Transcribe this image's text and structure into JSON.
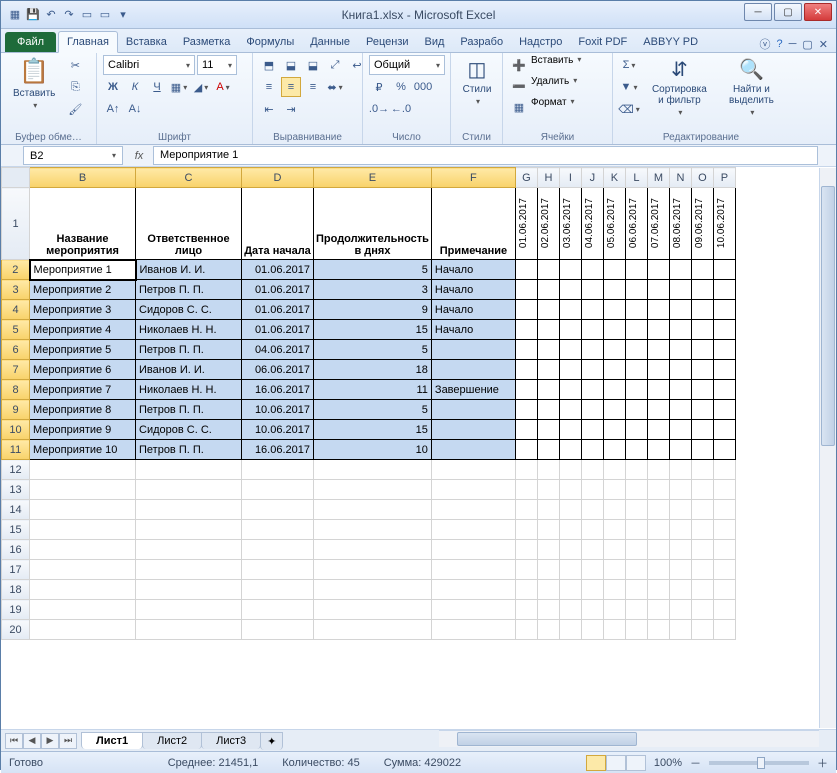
{
  "title": "Книга1.xlsx - Microsoft Excel",
  "tabs": {
    "file": "Файл",
    "home": "Главная",
    "insert": "Вставка",
    "layout": "Разметка",
    "formulas": "Формулы",
    "data": "Данные",
    "review": "Рецензи",
    "view": "Вид",
    "dev": "Разрабо",
    "add": "Надстро",
    "foxit": "Foxit PDF",
    "abbyy": "ABBYY PD"
  },
  "ribbon": {
    "clipboard": {
      "label": "Буфер обме…",
      "paste": "Вставить"
    },
    "font": {
      "label": "Шрифт",
      "name": "Calibri",
      "size": "11",
      "bold": "Ж",
      "italic": "К",
      "underline": "Ч"
    },
    "align": {
      "label": "Выравнивание"
    },
    "number": {
      "label": "Число",
      "format": "Общий"
    },
    "styles": {
      "label": "Стили",
      "btn": "Стили"
    },
    "cells": {
      "label": "Ячейки",
      "insert": "Вставить",
      "delete": "Удалить",
      "format": "Формат"
    },
    "editing": {
      "label": "Редактирование",
      "sort": "Сортировка и фильтр",
      "find": "Найти и выделить"
    }
  },
  "namebox": "B2",
  "formula": "Мероприятие 1",
  "columns": [
    "B",
    "C",
    "D",
    "E",
    "F",
    "G",
    "H",
    "I",
    "J",
    "K",
    "L",
    "M",
    "N",
    "O",
    "P"
  ],
  "headers": {
    "B": "Название мероприятия",
    "C": "Ответственное лицо",
    "D": "Дата начала",
    "E": "Продолжительность в днях",
    "F": "Примечание"
  },
  "date_headers": [
    "01.06.2017",
    "02.06.2017",
    "03.06.2017",
    "04.06.2017",
    "05.06.2017",
    "06.06.2017",
    "07.06.2017",
    "08.06.2017",
    "09.06.2017",
    "10.06.2017"
  ],
  "rows": [
    {
      "n": 2,
      "b": "Мероприятие 1",
      "c": "Иванов И. И.",
      "d": "01.06.2017",
      "e": "5",
      "f": "Начало"
    },
    {
      "n": 3,
      "b": "Мероприятие 2",
      "c": "Петров П. П.",
      "d": "01.06.2017",
      "e": "3",
      "f": "Начало"
    },
    {
      "n": 4,
      "b": "Мероприятие 3",
      "c": "Сидоров С. С.",
      "d": "01.06.2017",
      "e": "9",
      "f": "Начало"
    },
    {
      "n": 5,
      "b": "Мероприятие 4",
      "c": "Николаев Н. Н.",
      "d": "01.06.2017",
      "e": "15",
      "f": "Начало"
    },
    {
      "n": 6,
      "b": "Мероприятие 5",
      "c": "Петров П. П.",
      "d": "04.06.2017",
      "e": "5",
      "f": ""
    },
    {
      "n": 7,
      "b": "Мероприятие 6",
      "c": "Иванов И. И.",
      "d": "06.06.2017",
      "e": "18",
      "f": ""
    },
    {
      "n": 8,
      "b": "Мероприятие 7",
      "c": "Николаев Н. Н.",
      "d": "16.06.2017",
      "e": "11",
      "f": "Завершение"
    },
    {
      "n": 9,
      "b": "Мероприятие 8",
      "c": "Петров П. П.",
      "d": "10.06.2017",
      "e": "5",
      "f": ""
    },
    {
      "n": 10,
      "b": "Мероприятие 9",
      "c": "Сидоров С. С.",
      "d": "10.06.2017",
      "e": "15",
      "f": ""
    },
    {
      "n": 11,
      "b": "Мероприятие 10",
      "c": "Петров П. П.",
      "d": "16.06.2017",
      "e": "10",
      "f": ""
    }
  ],
  "empty_rows": [
    12,
    13,
    14,
    15,
    16,
    17,
    18,
    19,
    20
  ],
  "sheets": {
    "s1": "Лист1",
    "s2": "Лист2",
    "s3": "Лист3"
  },
  "status": {
    "ready": "Готово",
    "avg_label": "Среднее:",
    "avg": "21451,1",
    "count_label": "Количество:",
    "count": "45",
    "sum_label": "Сумма:",
    "sum": "429022",
    "zoom": "100%"
  }
}
